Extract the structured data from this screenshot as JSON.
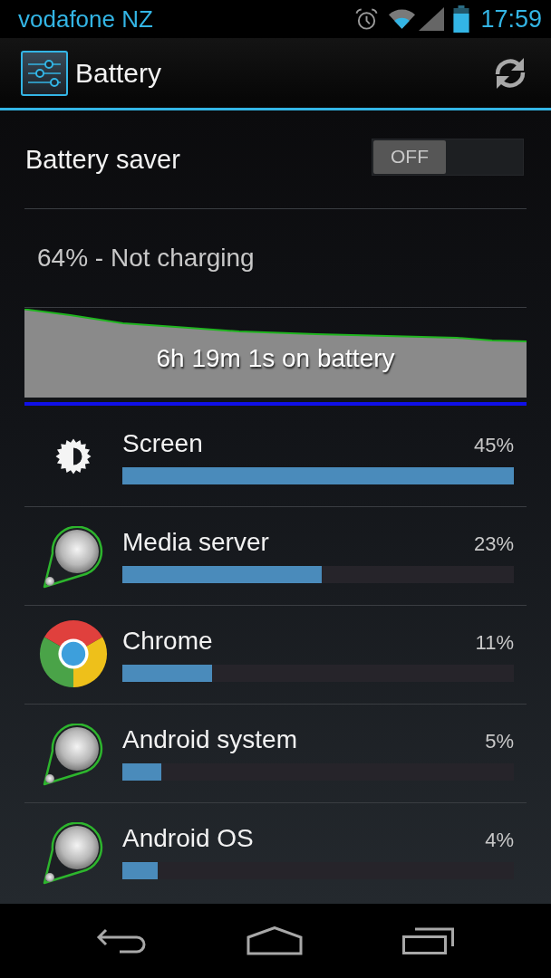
{
  "status_bar": {
    "carrier": "vodafone NZ",
    "time": "17:59"
  },
  "action_bar": {
    "title": "Battery"
  },
  "battery_saver": {
    "label": "Battery saver",
    "toggle": {
      "on": false,
      "text": "OFF"
    }
  },
  "battery_status": "64% - Not charging",
  "history_graph": {
    "caption": "6h 19m 1s on battery"
  },
  "usage": [
    {
      "kind": "screen",
      "name": "Screen",
      "percent": "45%",
      "level": 1.0
    },
    {
      "kind": "app",
      "name": "Media server",
      "percent": "23%",
      "level": 0.51
    },
    {
      "kind": "chrome",
      "name": "Chrome",
      "percent": "11%",
      "level": 0.23
    },
    {
      "kind": "app",
      "name": "Android system",
      "percent": "5%",
      "level": 0.1
    },
    {
      "kind": "app",
      "name": "Android OS",
      "percent": "4%",
      "level": 0.09
    }
  ]
}
